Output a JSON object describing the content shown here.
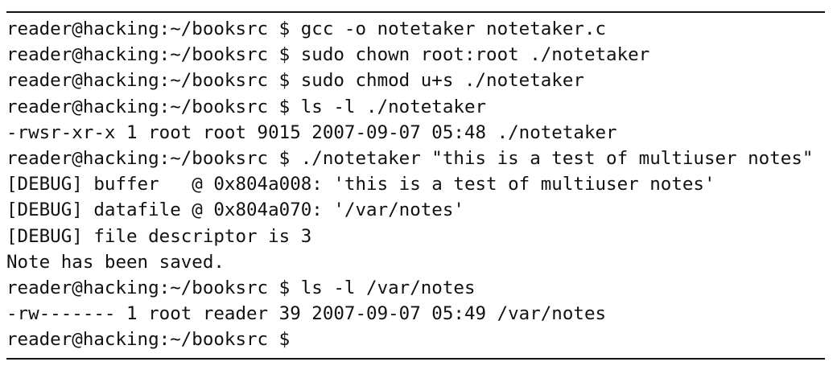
{
  "terminal": {
    "lines": [
      "reader@hacking:~/booksrc $ gcc -o notetaker notetaker.c",
      "reader@hacking:~/booksrc $ sudo chown root:root ./notetaker",
      "reader@hacking:~/booksrc $ sudo chmod u+s ./notetaker",
      "reader@hacking:~/booksrc $ ls -l ./notetaker",
      "-rwsr-xr-x 1 root root 9015 2007-09-07 05:48 ./notetaker",
      "reader@hacking:~/booksrc $ ./notetaker \"this is a test of multiuser notes\"",
      "[DEBUG] buffer   @ 0x804a008: 'this is a test of multiuser notes'",
      "[DEBUG] datafile @ 0x804a070: '/var/notes'",
      "[DEBUG] file descriptor is 3",
      "Note has been saved.",
      "reader@hacking:~/booksrc $ ls -l /var/notes",
      "-rw------- 1 root reader 39 2007-09-07 05:49 /var/notes",
      "reader@hacking:~/booksrc $ "
    ]
  }
}
